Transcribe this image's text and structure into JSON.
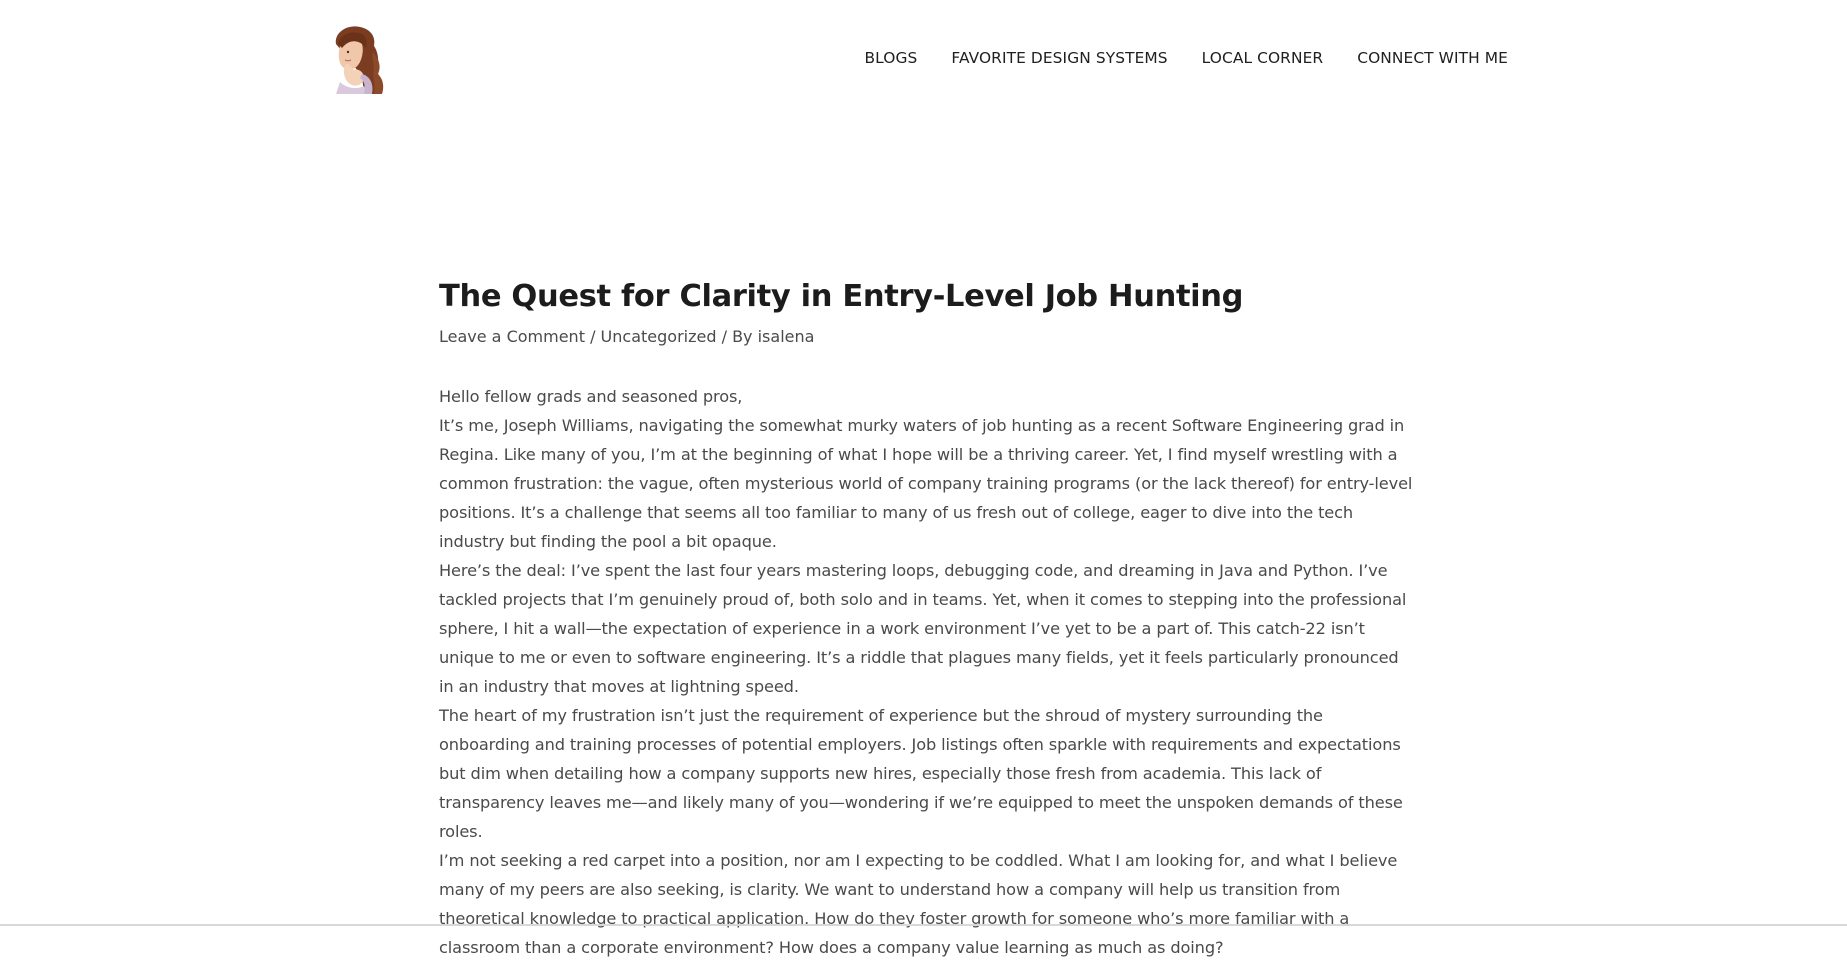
{
  "header": {
    "logo_alt": "Vintage portrait illustration of a woman with a raised hand",
    "nav": [
      "BLOGS",
      "FAVORITE DESIGN SYSTEMS",
      "LOCAL CORNER",
      "CONNECT WITH ME"
    ]
  },
  "post": {
    "title": "The Quest for Clarity in Entry-Level Job Hunting",
    "meta": {
      "comment_link": "Leave a Comment",
      "separator": "/",
      "category": "Uncategorized",
      "by_prefix": "By",
      "author": "isalena"
    },
    "paragraphs": [
      "Hello fellow grads and seasoned pros,",
      "It’s me, Joseph Williams, navigating the somewhat murky waters of job hunting as a recent Software Engineering grad in Regina. Like many of you, I’m at the beginning of what I hope will be a thriving career. Yet, I find myself wrestling with a common frustration: the vague, often mysterious world of company training programs (or the lack thereof) for entry-level positions. It’s a challenge that seems all too familiar to many of us fresh out of college, eager to dive into the tech industry but finding the pool a bit opaque.",
      "Here’s the deal: I’ve spent the last four years mastering loops, debugging code, and dreaming in Java and Python. I’ve tackled projects that I’m genuinely proud of, both solo and in teams. Yet, when it comes to stepping into the professional sphere, I hit a wall—the expectation of experience in a work environment I’ve yet to be a part of. This catch-22 isn’t unique to me or even to software engineering. It’s a riddle that plagues many fields, yet it feels particularly pronounced in an industry that moves at lightning speed.",
      "The heart of my frustration isn’t just the requirement of experience but the shroud of mystery surrounding the onboarding and training processes of potential employers. Job listings often sparkle with requirements and expectations but dim when detailing how a company supports new hires, especially those fresh from academia. This lack of transparency leaves me—and likely many of you—wondering if we’re equipped to meet the unspoken demands of these roles.",
      "I’m not seeking a red carpet into a position, nor am I expecting to be coddled. What I am looking for, and what I believe many of my peers are also seeking, is clarity. We want to understand how a company will help us transition from theoretical knowledge to practical application. How do they foster growth for someone who’s more familiar with a classroom than a corporate environment? How does a company value learning as much as doing?"
    ]
  }
}
